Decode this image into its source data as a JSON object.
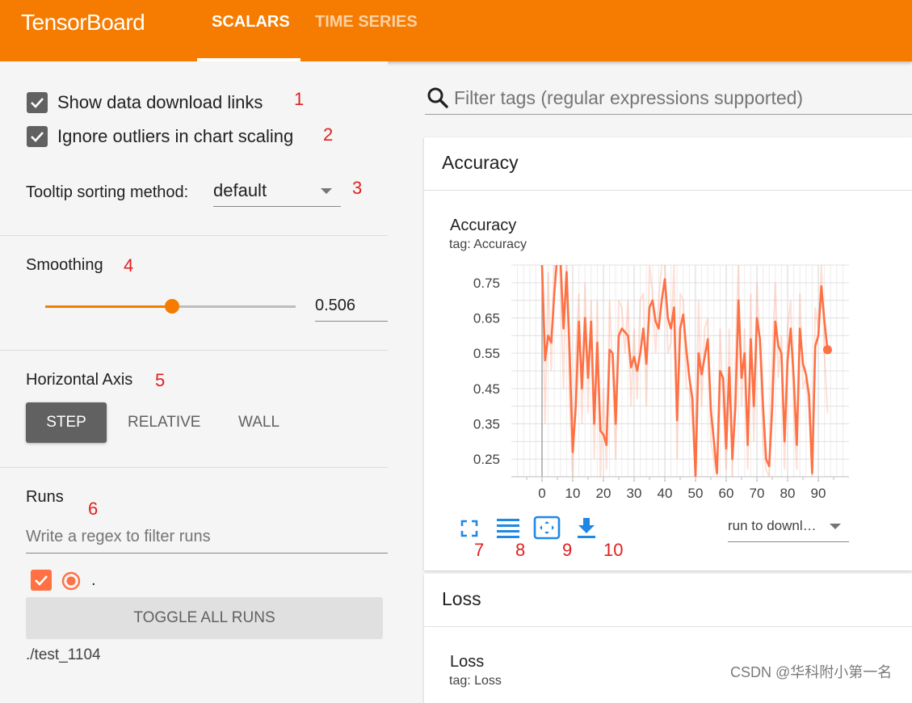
{
  "header": {
    "app_title": "TensorBoard",
    "tabs": [
      {
        "label": "SCALARS",
        "active": true
      },
      {
        "label": "TIME SERIES",
        "active": false
      }
    ],
    "bar_color": "#f57c00"
  },
  "sidebar": {
    "show_download_links": {
      "label": "Show data download links",
      "checked": true,
      "marker": "1"
    },
    "ignore_outliers": {
      "label": "Ignore outliers in chart scaling",
      "checked": true,
      "marker": "2"
    },
    "tooltip_sorting": {
      "label": "Tooltip sorting method:",
      "value": "default",
      "marker": "3"
    },
    "smoothing": {
      "label": "Smoothing",
      "value": 0.506,
      "value_text": "0.506",
      "marker": "4"
    },
    "horizontal_axis": {
      "label": "Horizontal Axis",
      "marker": "5",
      "options": [
        "STEP",
        "RELATIVE",
        "WALL"
      ],
      "selected": "STEP"
    },
    "runs": {
      "label": "Runs",
      "marker": "6",
      "filter_placeholder": "Write a regex to filter runs",
      "run_name": ".",
      "run_checked": true,
      "run_color": "#ff7043",
      "toggle_label": "TOGGLE ALL RUNS",
      "logdir": "./test_1104"
    }
  },
  "main": {
    "filter_placeholder": "Filter tags (regular expressions supported)",
    "cards": [
      {
        "title": "Accuracy",
        "chart_title": "Accuracy",
        "chart_tag": "tag: Accuracy"
      },
      {
        "title": "Loss",
        "chart_title": "Loss",
        "chart_tag": "tag: Loss"
      }
    ],
    "download_select": {
      "value": "run to downl…"
    },
    "icon_markers": [
      "7",
      "8",
      "9",
      "10"
    ]
  },
  "chart_data": {
    "type": "line",
    "title": "Accuracy",
    "subtitle": "tag: Accuracy",
    "xlabel": "",
    "ylabel": "",
    "x_ticks": [
      "0",
      "10",
      "20",
      "30",
      "40",
      "50",
      "60",
      "70",
      "80",
      "90"
    ],
    "y_ticks": [
      "0.75",
      "0.65",
      "0.55",
      "0.45",
      "0.35",
      "0.25"
    ],
    "xlim": [
      -10,
      100
    ],
    "ylim": [
      0.2,
      0.8
    ],
    "grid": true,
    "series": [
      {
        "color": "#ff7043",
        "x": [
          0,
          1,
          2,
          3,
          4,
          5,
          6,
          7,
          8,
          9,
          10,
          11,
          12,
          13,
          14,
          15,
          16,
          17,
          18,
          19,
          20,
          21,
          22,
          23,
          24,
          25,
          26,
          27,
          28,
          29,
          30,
          31,
          32,
          33,
          34,
          35,
          36,
          37,
          38,
          39,
          40,
          41,
          42,
          43,
          44,
          45,
          46,
          47,
          48,
          49,
          50,
          51,
          52,
          53,
          54,
          55,
          56,
          57,
          58,
          59,
          60,
          61,
          62,
          63,
          64,
          65,
          66,
          67,
          68,
          69,
          70,
          71,
          72,
          73,
          74,
          75,
          76,
          77,
          78,
          79,
          80,
          81,
          82,
          83,
          84,
          85,
          86,
          87,
          88,
          89,
          90,
          91,
          92,
          93
        ],
        "smoothed": [
          0.8,
          0.53,
          0.6,
          0.58,
          0.72,
          0.83,
          0.82,
          0.62,
          0.78,
          0.55,
          0.27,
          0.4,
          0.64,
          0.45,
          0.65,
          0.48,
          0.64,
          0.35,
          0.58,
          0.33,
          0.32,
          0.29,
          0.56,
          0.55,
          0.35,
          0.6,
          0.62,
          0.61,
          0.6,
          0.51,
          0.54,
          0.5,
          0.55,
          0.62,
          0.52,
          0.68,
          0.7,
          0.64,
          0.62,
          0.7,
          0.76,
          0.65,
          0.62,
          0.68,
          0.36,
          0.62,
          0.66,
          0.56,
          0.48,
          0.42,
          0.2,
          0.55,
          0.49,
          0.54,
          0.59,
          0.39,
          0.3,
          0.21,
          0.5,
          0.48,
          0.28,
          0.51,
          0.25,
          0.4,
          0.7,
          0.48,
          0.55,
          0.29,
          0.59,
          0.4,
          0.65,
          0.59,
          0.4,
          0.25,
          0.23,
          0.4,
          0.64,
          0.57,
          0.55,
          0.3,
          0.53,
          0.62,
          0.48,
          0.29,
          0.62,
          0.52,
          0.49,
          0.43,
          0.21,
          0.57,
          0.6,
          0.74,
          0.64,
          0.56
        ],
        "raw": [
          0.8,
          0.35,
          0.78,
          0.5,
          0.85,
          0.9,
          0.75,
          0.45,
          0.88,
          0.4,
          0.2,
          0.55,
          0.72,
          0.35,
          0.75,
          0.38,
          0.7,
          0.25,
          0.7,
          0.2,
          0.45,
          0.22,
          0.7,
          0.5,
          0.25,
          0.7,
          0.68,
          0.55,
          0.7,
          0.4,
          0.62,
          0.42,
          0.7,
          0.72,
          0.4,
          0.8,
          0.72,
          0.55,
          0.7,
          0.8,
          0.82,
          0.55,
          0.58,
          0.8,
          0.25,
          0.72,
          0.7,
          0.45,
          0.45,
          0.35,
          0.2,
          0.7,
          0.4,
          0.62,
          0.65,
          0.3,
          0.25,
          0.2,
          0.62,
          0.4,
          0.22,
          0.62,
          0.2,
          0.55,
          0.8,
          0.4,
          0.62,
          0.22,
          0.72,
          0.3,
          0.75,
          0.55,
          0.3,
          0.22,
          0.2,
          0.55,
          0.75,
          0.48,
          0.6,
          0.22,
          0.62,
          0.7,
          0.38,
          0.22,
          0.72,
          0.45,
          0.48,
          0.38,
          0.2,
          0.68,
          0.62,
          0.8,
          0.55,
          0.38
        ]
      }
    ]
  },
  "watermark": "CSDN @华科附小第一名"
}
